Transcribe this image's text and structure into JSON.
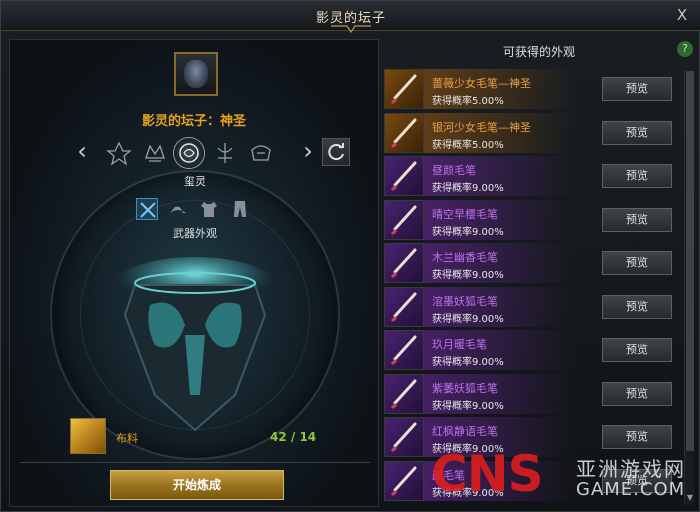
{
  "window": {
    "title": "影灵的坛子",
    "close_label": "X"
  },
  "item": {
    "name": "影灵的坛子：神圣"
  },
  "categories": {
    "prev_label": "‹",
    "next_label": "›",
    "selected_label": "玺灵"
  },
  "subcategories": {
    "selected_label": "武器外观"
  },
  "material": {
    "name": "布料",
    "count": "42 / 14"
  },
  "craft_button": "开始炼成",
  "right": {
    "title": "可获得的外观",
    "help_label": "?"
  },
  "rewards": [
    {
      "name": "蔷薇少女毛笔—神圣",
      "rate": "获得概率5.00%",
      "grade": "gold",
      "preview": "预览"
    },
    {
      "name": "银河少女毛笔—神圣",
      "rate": "获得概率5.00%",
      "grade": "gold",
      "preview": "预览"
    },
    {
      "name": "昼颜毛笔",
      "rate": "获得概率9.00%",
      "grade": "purple",
      "preview": "预览"
    },
    {
      "name": "晴空早樱毛笔",
      "rate": "获得概率9.00%",
      "grade": "purple",
      "preview": "预览"
    },
    {
      "name": "木兰幽香毛笔",
      "rate": "获得概率9.00%",
      "grade": "purple",
      "preview": "预览"
    },
    {
      "name": "涫墨妖狐毛笔",
      "rate": "获得概率9.00%",
      "grade": "purple",
      "preview": "预览"
    },
    {
      "name": "玖月暖毛笔",
      "rate": "获得概率9.00%",
      "grade": "purple",
      "preview": "预览"
    },
    {
      "name": "紫萎妖狐毛笔",
      "rate": "获得概率9.00%",
      "grade": "purple",
      "preview": "预览"
    },
    {
      "name": "红枫静语毛笔",
      "rate": "获得概率9.00%",
      "grade": "purple",
      "preview": "预览"
    },
    {
      "name": "颜毛笔",
      "rate": "获得概率9.00%",
      "grade": "purple",
      "preview": "预览"
    }
  ],
  "watermark": {
    "logo": "CNS",
    "cn": "亚洲游戏网",
    "en": "GAME.COM"
  },
  "colors": {
    "gold": "#f0a040",
    "purple": "#c070f0",
    "count_green": "#8ec83a",
    "accent": "#e8a020"
  }
}
